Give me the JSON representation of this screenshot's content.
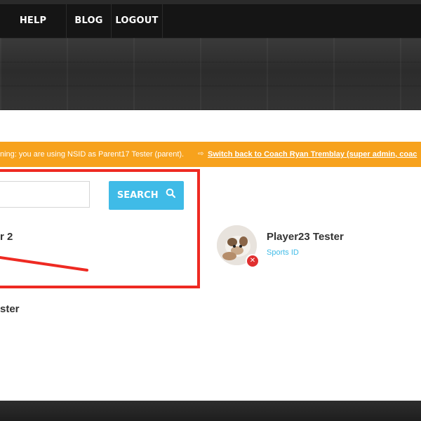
{
  "nav": {
    "help_desk": "HELP DESK",
    "blog": "BLOG",
    "logout": "LOGOUT"
  },
  "warning": {
    "message": "ning: you are using NSID as Parent17 Tester (parent).",
    "switch_link": "Switch back to Coach Ryan Tremblay (super admin, coac"
  },
  "search": {
    "value": "",
    "button_label": "SEARCH"
  },
  "players": {
    "left_partial_1": "r 2",
    "left_partial_2": "ster",
    "card_name": "Player23 Tester",
    "card_link": "Sports ID"
  },
  "colors": {
    "accent": "#3fbbe7",
    "warning": "#f7a21d",
    "highlight": "#ee2a22",
    "remove": "#e02f2f"
  }
}
